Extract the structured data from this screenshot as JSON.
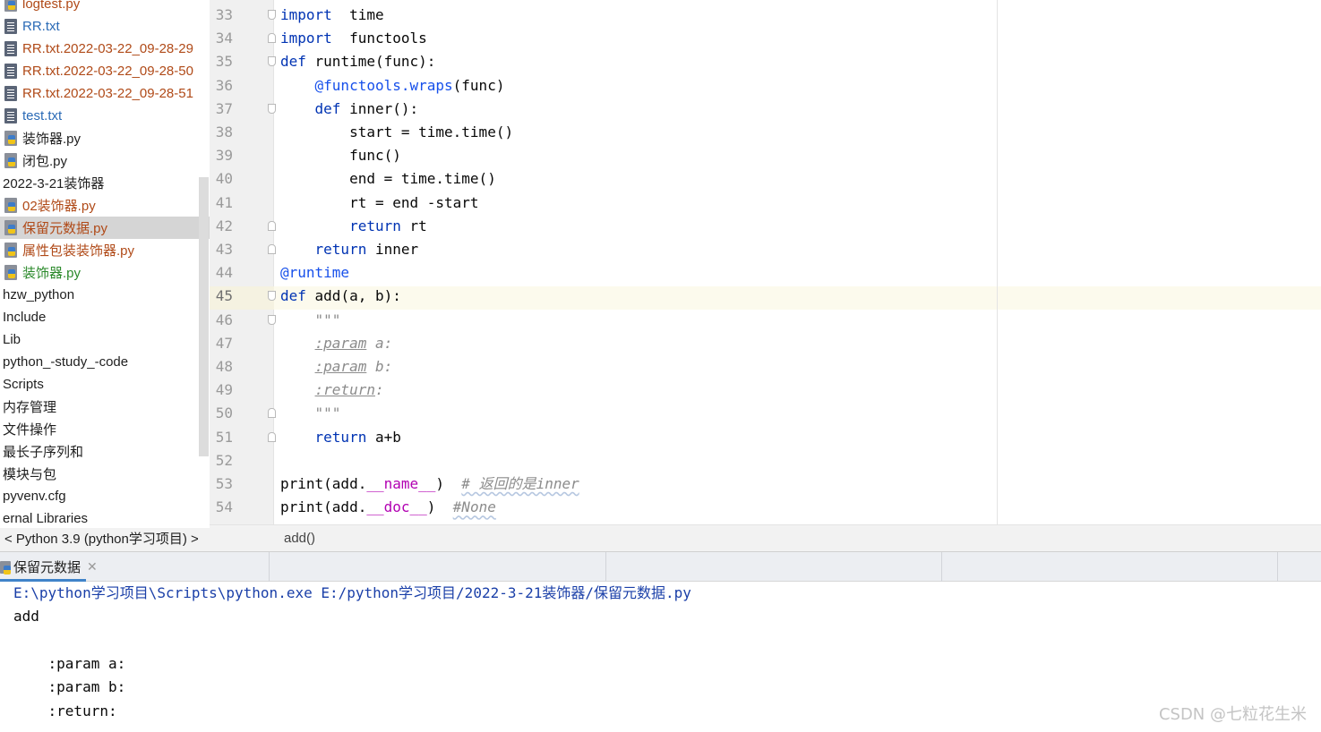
{
  "tree": {
    "items": [
      {
        "label": "logtest.py",
        "icon": "python-file-icon",
        "color": "brown"
      },
      {
        "label": "RR.txt",
        "icon": "text-file-icon",
        "color": "blue"
      },
      {
        "label": "RR.txt.2022-03-22_09-28-29",
        "icon": "text-file-icon",
        "color": "brown"
      },
      {
        "label": "RR.txt.2022-03-22_09-28-50",
        "icon": "text-file-icon",
        "color": "brown"
      },
      {
        "label": "RR.txt.2022-03-22_09-28-51",
        "icon": "text-file-icon",
        "color": "brown"
      },
      {
        "label": "test.txt",
        "icon": "text-file-icon",
        "color": "blue"
      },
      {
        "label": "装饰器.py",
        "icon": "python-file-icon",
        "color": "dark"
      },
      {
        "label": "闭包.py",
        "icon": "python-file-icon",
        "color": "dark"
      },
      {
        "label": "2022-3-21装饰器",
        "icon": "",
        "color": "dark"
      },
      {
        "label": "02装饰器.py",
        "icon": "python-file-icon",
        "color": "brown"
      },
      {
        "label": "保留元数据.py",
        "icon": "python-file-icon",
        "color": "brown",
        "selected": true
      },
      {
        "label": "属性包装装饰器.py",
        "icon": "python-file-icon",
        "color": "brown"
      },
      {
        "label": "装饰器.py",
        "icon": "python-file-icon",
        "color": "green"
      },
      {
        "label": "hzw_python",
        "icon": "",
        "color": "dark"
      },
      {
        "label": "Include",
        "icon": "",
        "color": "dark"
      },
      {
        "label": "Lib",
        "icon": "",
        "color": "dark"
      },
      {
        "label": "python_-study_-code",
        "icon": "",
        "color": "dark"
      },
      {
        "label": "Scripts",
        "icon": "",
        "color": "dark"
      },
      {
        "label": "内存管理",
        "icon": "",
        "color": "dark"
      },
      {
        "label": "文件操作",
        "icon": "",
        "color": "dark"
      },
      {
        "label": "最长子序列和",
        "icon": "",
        "color": "dark"
      },
      {
        "label": "模块与包",
        "icon": "",
        "color": "dark"
      },
      {
        "label": "pyvenv.cfg",
        "icon": "",
        "color": "dark"
      },
      {
        "label": "ernal Libraries",
        "icon": "",
        "color": "dark"
      }
    ],
    "footer": "< Python 3.9 (python学习项目) >"
  },
  "editor": {
    "current_line": 45,
    "lines": [
      {
        "n": "33",
        "fold": "open",
        "tokens": [
          [
            "kw",
            "import"
          ],
          [
            "",
            "  time"
          ]
        ]
      },
      {
        "n": "34",
        "fold": "close",
        "tokens": [
          [
            "kw",
            "import"
          ],
          [
            "",
            "  functools"
          ]
        ]
      },
      {
        "n": "35",
        "fold": "open",
        "tokens": [
          [
            "kw",
            "def"
          ],
          [
            "",
            " runtime(func):"
          ]
        ]
      },
      {
        "n": "36",
        "fold": "",
        "tokens": [
          [
            "",
            "    "
          ],
          [
            "deco",
            "@functools.wraps"
          ],
          [
            "",
            "(func)"
          ]
        ]
      },
      {
        "n": "37",
        "fold": "open",
        "tokens": [
          [
            "",
            "    "
          ],
          [
            "kw",
            "def"
          ],
          [
            "",
            " inner():"
          ]
        ]
      },
      {
        "n": "38",
        "fold": "",
        "tokens": [
          [
            "",
            "        start = time.time()"
          ]
        ]
      },
      {
        "n": "39",
        "fold": "",
        "tokens": [
          [
            "",
            "        func()"
          ]
        ]
      },
      {
        "n": "40",
        "fold": "",
        "tokens": [
          [
            "",
            "        end = time.time()"
          ]
        ]
      },
      {
        "n": "41",
        "fold": "",
        "tokens": [
          [
            "",
            "        rt = end -start"
          ]
        ]
      },
      {
        "n": "42",
        "fold": "close",
        "tokens": [
          [
            "",
            "        "
          ],
          [
            "kw",
            "return"
          ],
          [
            "",
            " rt"
          ]
        ]
      },
      {
        "n": "43",
        "fold": "close",
        "tokens": [
          [
            "",
            "    "
          ],
          [
            "kw",
            "return"
          ],
          [
            "",
            " inner"
          ]
        ]
      },
      {
        "n": "44",
        "fold": "",
        "tokens": [
          [
            "deco",
            "@runtime"
          ]
        ]
      },
      {
        "n": "45",
        "fold": "open",
        "tokens": [
          [
            "kw",
            "def"
          ],
          [
            "",
            " add(a, b):"
          ]
        ]
      },
      {
        "n": "46",
        "fold": "open",
        "tokens": [
          [
            "doc",
            "    \"\"\""
          ]
        ]
      },
      {
        "n": "47",
        "fold": "",
        "tokens": [
          [
            "",
            "    "
          ],
          [
            "doctag",
            ":param"
          ],
          [
            "doc",
            " a:"
          ]
        ]
      },
      {
        "n": "48",
        "fold": "",
        "tokens": [
          [
            "",
            "    "
          ],
          [
            "doctag",
            ":param"
          ],
          [
            "doc",
            " b:"
          ]
        ]
      },
      {
        "n": "49",
        "fold": "",
        "tokens": [
          [
            "",
            "    "
          ],
          [
            "doctag",
            ":return"
          ],
          [
            "doc",
            ":"
          ]
        ]
      },
      {
        "n": "50",
        "fold": "close",
        "tokens": [
          [
            "doc",
            "    \"\"\""
          ]
        ]
      },
      {
        "n": "51",
        "fold": "close",
        "tokens": [
          [
            "",
            "    "
          ],
          [
            "kw",
            "return"
          ],
          [
            "",
            " a+b"
          ]
        ]
      },
      {
        "n": "52",
        "fold": "",
        "tokens": []
      },
      {
        "n": "53",
        "fold": "",
        "tokens": [
          [
            "",
            "print(add."
          ],
          [
            "dunder",
            "__name__"
          ],
          [
            "",
            ")  "
          ],
          [
            "cmt",
            "# 返回的是inner"
          ]
        ]
      },
      {
        "n": "54",
        "fold": "",
        "tokens": [
          [
            "",
            "print(add."
          ],
          [
            "dunder",
            "__doc__"
          ],
          [
            "",
            ")  "
          ],
          [
            "cmt",
            "#None"
          ]
        ]
      }
    ],
    "breadcrumb": "add()"
  },
  "run": {
    "tab_label": "保留元数据",
    "console": [
      {
        "kind": "cmd",
        "text": "E:\\python学习项目\\Scripts\\python.exe E:/python学习项目/2022-3-21装饰器/保留元数据.py"
      },
      {
        "kind": "out",
        "text": "add"
      },
      {
        "kind": "out",
        "text": ""
      },
      {
        "kind": "out",
        "text": "    :param a:"
      },
      {
        "kind": "out",
        "text": "    :param b:"
      },
      {
        "kind": "out",
        "text": "    :return:"
      }
    ]
  },
  "watermark": "CSDN @七粒花生米",
  "colors": {
    "keyword": "#0033b3",
    "decorator": "#1750eb",
    "dunder": "#b200b2",
    "comment": "#8c8c8c",
    "file_blue": "#2a6ab6",
    "file_brown": "#b04a18",
    "file_green": "#2b8a2b",
    "selection": "#d5d5d5",
    "tab_underline": "#4083c9"
  }
}
